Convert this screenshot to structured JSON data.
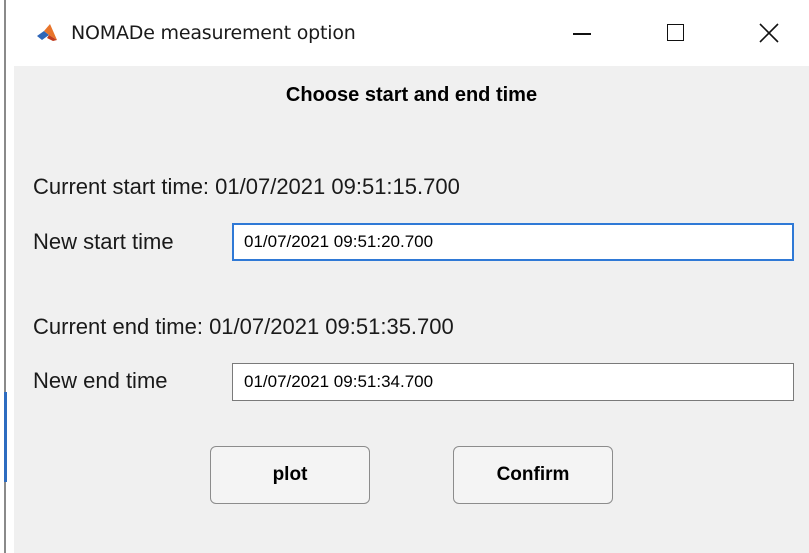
{
  "window": {
    "title": "NOMADe measurement option",
    "icon": "matlab-logo-icon",
    "controls": [
      "minimize-icon",
      "maximize-icon",
      "close-icon"
    ]
  },
  "heading": "Choose start and end time",
  "start": {
    "current_text": "Current start time: 01/07/2021 09:51:15.700",
    "label": "New start time",
    "value": "01/07/2021 09:51:20.700"
  },
  "end": {
    "current_text": "Current end time: 01/07/2021 09:51:35.700",
    "label": "New end time",
    "value": "01/07/2021 09:51:34.700"
  },
  "buttons": {
    "plot": "plot",
    "confirm": "Confirm"
  },
  "colors": {
    "background": "#f0f0f0",
    "focus_border": "#2f79d6"
  }
}
